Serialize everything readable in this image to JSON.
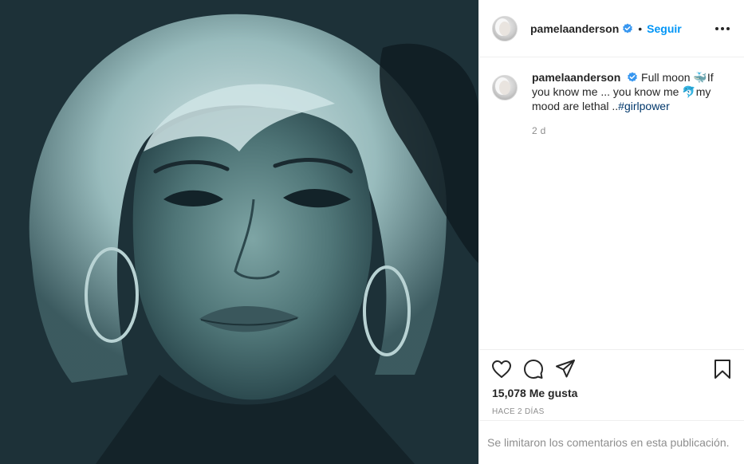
{
  "post": {
    "photo_icon": "portrait-photo",
    "author": {
      "username": "pamelaanderson",
      "verified": true,
      "follow_label": "Seguir"
    },
    "caption": {
      "text_before_hashtag": "Full moon 🐳If you know me ... you know me 🐬my mood are lethal ..",
      "hashtag": "#girlpower",
      "time_ago": "2 d"
    },
    "likes_text": "15,078 Me gusta",
    "posted_date": "HACE 2 DÍAS",
    "comments_notice": "Se limitaron los comentarios en esta publicación."
  },
  "colors": {
    "link_blue": "#0095f6",
    "hashtag": "#00376b",
    "secondary_text": "#8e8e8e",
    "border": "#efefef"
  },
  "icons": [
    "verified-badge-icon",
    "more-options-icon",
    "heart-icon",
    "comment-icon",
    "share-icon",
    "bookmark-icon",
    "whale-emoji",
    "dolphin-emoji"
  ]
}
